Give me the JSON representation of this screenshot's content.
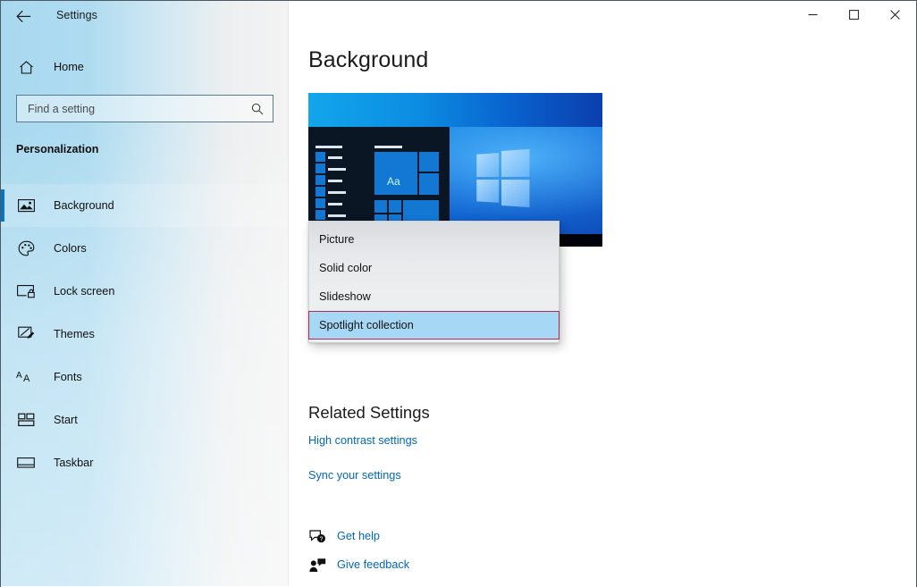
{
  "window": {
    "title": "Settings",
    "back_icon": "back-arrow-icon",
    "minimize_label": "—",
    "maximize_label": "□",
    "close_label": "✕"
  },
  "sidebar": {
    "home_label": "Home",
    "home_icon": "home-icon",
    "search": {
      "placeholder": "Find a setting",
      "value": "",
      "icon": "search-icon"
    },
    "section_label": "Personalization",
    "items": [
      {
        "label": "Background",
        "icon": "picture-icon",
        "selected": true
      },
      {
        "label": "Colors",
        "icon": "palette-icon",
        "selected": false
      },
      {
        "label": "Lock screen",
        "icon": "lock-screen-icon",
        "selected": false
      },
      {
        "label": "Themes",
        "icon": "brush-icon",
        "selected": false
      },
      {
        "label": "Fonts",
        "icon": "fonts-icon",
        "selected": false
      },
      {
        "label": "Start",
        "icon": "start-icon",
        "selected": false
      },
      {
        "label": "Taskbar",
        "icon": "taskbar-icon",
        "selected": false
      }
    ]
  },
  "main": {
    "page_title": "Background",
    "preview": {
      "name": "desktop-background-preview",
      "sample_text": "Aa"
    },
    "background_dropdown": {
      "expanded": true,
      "selected": "Spotlight collection",
      "options": [
        "Picture",
        "Solid color",
        "Slideshow",
        "Spotlight collection"
      ]
    },
    "related_settings": {
      "title": "Related Settings",
      "links": [
        "High contrast settings",
        "Sync your settings"
      ]
    },
    "footer_links": [
      {
        "label": "Get help",
        "icon": "help-bubble-icon"
      },
      {
        "label": "Give feedback",
        "icon": "feedback-person-icon"
      }
    ]
  },
  "colors": {
    "accent": "#0a74c4",
    "link": "#0067c0",
    "selection_fill": "#a6d8f5",
    "selection_border": "#ad2b4c",
    "sidebar_blue": "#a9d9ef",
    "dropdown_bg": "#eceeef"
  }
}
